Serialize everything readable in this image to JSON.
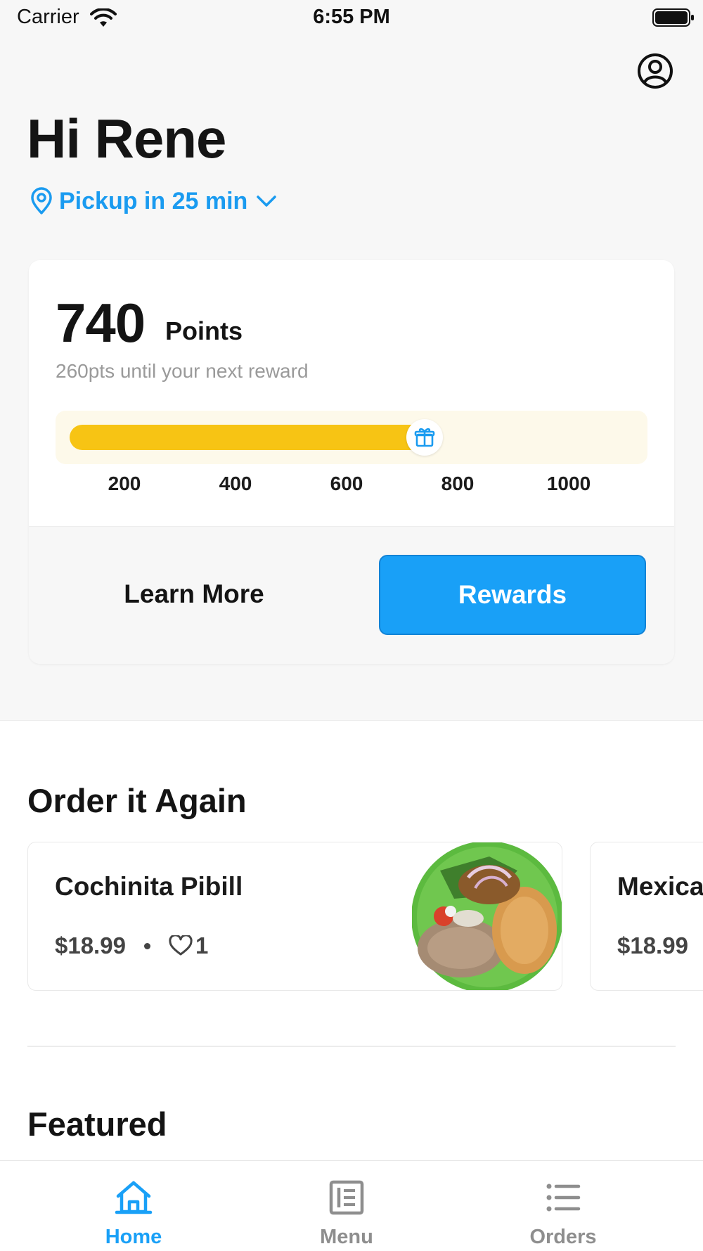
{
  "status_bar": {
    "carrier": "Carrier",
    "time": "6:55 PM"
  },
  "header": {
    "greeting": "Hi Rene",
    "pickup_label": "Pickup in 25 min"
  },
  "points_card": {
    "points_value": "740",
    "points_label": "Points",
    "points_subtitle": "260pts until your next reward",
    "progress": {
      "current": 740,
      "max": 1000,
      "ticks": [
        "200",
        "400",
        "600",
        "800",
        "1000"
      ]
    },
    "learn_more_label": "Learn More",
    "rewards_label": "Rewards"
  },
  "order_again": {
    "title": "Order it Again",
    "items": [
      {
        "name": "Cochinita Pibill",
        "price": "$18.99",
        "likes": "1"
      },
      {
        "name": "Mexica",
        "price": "$18.99"
      }
    ]
  },
  "featured": {
    "title": "Featured"
  },
  "tab_bar": {
    "tabs": [
      {
        "label": "Home",
        "icon": "home-icon",
        "active": true
      },
      {
        "label": "Menu",
        "icon": "menu-icon",
        "active": false
      },
      {
        "label": "Orders",
        "icon": "orders-icon",
        "active": false
      }
    ]
  },
  "colors": {
    "accent": "#19a0f7",
    "progress_fill": "#f7c414",
    "progress_track": "#fdf9ea",
    "inactive_tab": "#8e8e8e"
  }
}
